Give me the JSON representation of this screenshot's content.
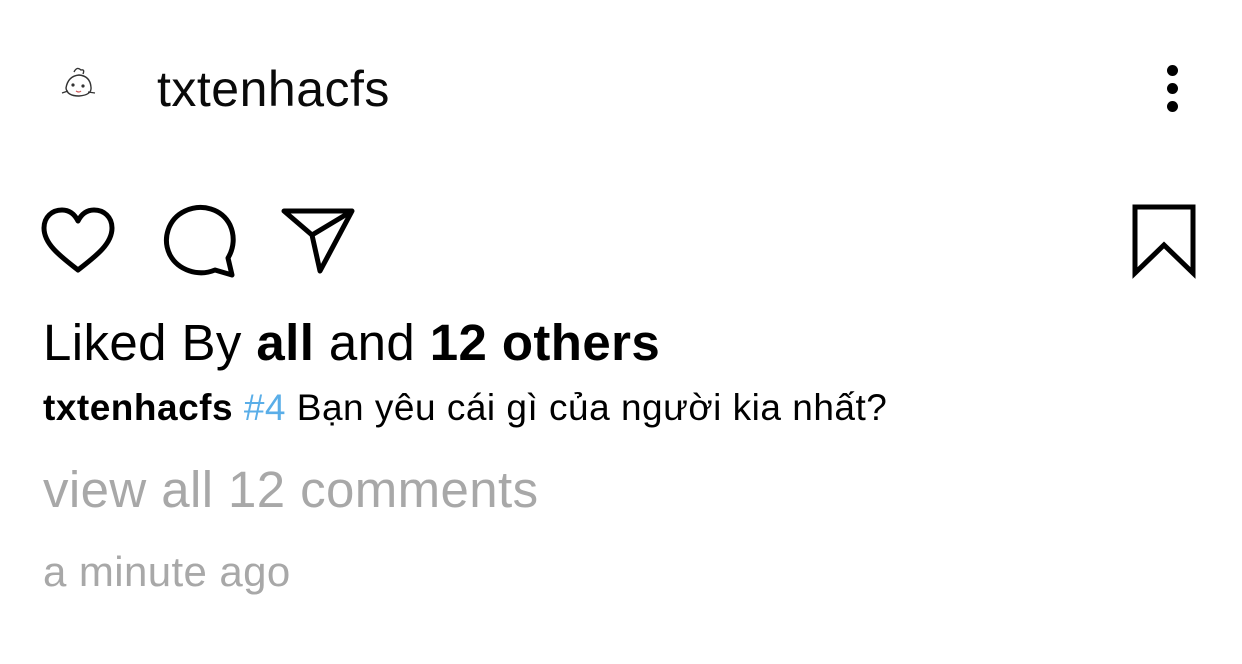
{
  "post": {
    "username": "txtenhacfs",
    "avatar_icon": "cartoon-avatar-icon",
    "more_icon": "more-vertical-icon"
  },
  "actions": {
    "like_icon": "heart-icon",
    "comment_icon": "comment-bubble-icon",
    "share_icon": "paper-plane-icon",
    "save_icon": "bookmark-icon"
  },
  "likes": {
    "prefix": "Liked By ",
    "name": "all",
    "middle": " and ",
    "others": "12 others"
  },
  "caption": {
    "username": "txtenhacfs",
    "hashtag": "#4",
    "text": " Bạn yêu cái gì của người kia nhất?"
  },
  "comments": {
    "view_all": "view all 12 comments"
  },
  "timestamp": "a minute ago",
  "colors": {
    "hashtag": "#5aaee8",
    "muted_text": "#a8a8a8",
    "text": "#000000"
  }
}
